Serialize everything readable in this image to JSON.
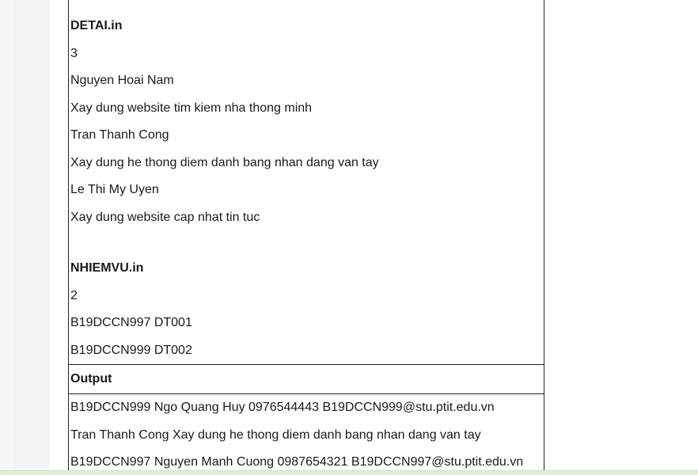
{
  "input": {
    "detai_file": "DETAI.in",
    "detai_count": "3",
    "detai_lines": [
      "Nguyen Hoai Nam",
      "Xay dung website tim kiem nha thong minh",
      "Tran Thanh Cong",
      "Xay dung he thong diem danh bang nhan dang van tay",
      "Le Thi My Uyen",
      "Xay dung website cap nhat tin tuc"
    ],
    "nhiemvu_file": "NHIEMVU.in",
    "nhiemvu_count": "2",
    "nhiemvu_lines": [
      "B19DCCN997 DT001",
      "B19DCCN999 DT002"
    ]
  },
  "output": {
    "heading": "Output",
    "lines": [
      "B19DCCN999 Ngo Quang Huy 0976544443 B19DCCN999@stu.ptit.edu.vn",
      "Tran Thanh Cong Xay dung he thong diem danh bang nhan dang van tay",
      "B19DCCN997 Nguyen Manh Cuong 0987654321 B19DCCN997@stu.ptit.edu.vn"
    ]
  },
  "colors": {
    "border": "#222222",
    "bottom_bar": "#dff0d8"
  }
}
